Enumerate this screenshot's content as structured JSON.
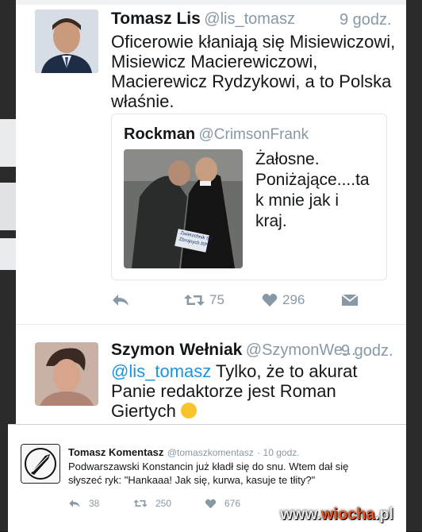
{
  "tweet1": {
    "name": "Tomasz Lis",
    "handle": "@lis_tomasz",
    "time": "9 godz.",
    "lines": [
      "Oficerowie kłaniają się Misiewiczowi,",
      "Misiewicz Macierewiczowi,",
      "Macierewicz Rydzykowi, a to Polska",
      "właśnie."
    ],
    "quote": {
      "name": "Rockman",
      "handle": "@CrimsonFrank",
      "lines": [
        "Żałosne.",
        "Poniżające....ta",
        "k mnie jak i",
        "kraj."
      ],
      "photo_sign": [
        "Zwierzchnik SZ",
        "Zbrojnych RP"
      ]
    },
    "actions": {
      "retweets": "75",
      "likes": "296"
    }
  },
  "tweet2": {
    "name": "Szymon Wełniak",
    "handle": "@SzymonWe...",
    "time": "9 godz.",
    "mention": "@lis_tomasz",
    "lines": [
      " Tylko, że to akurat",
      "Panie redaktorze jest Roman",
      "Giertych"
    ]
  },
  "overlay": {
    "name": "Tomasz Komentasz",
    "handle": "@tomaszkomentasz",
    "time": "· 10 godz.",
    "lines": [
      "Podwarszawski Konstancin już kładł się do snu. Wtem dał się",
      "słyszeć ryk: \"Hankaaa! Jak się, kurwa, kasuje te tłity?\""
    ],
    "actions": {
      "replies": "38",
      "retweets": "250",
      "likes": "676"
    }
  },
  "watermark": {
    "prefix": "www.",
    "brand": "wiocha",
    "suffix": ".pl"
  },
  "colors": {
    "link": "#1b95e0",
    "muted": "#8899a6",
    "divider": "#e6ecf0",
    "watermark_accent": "#e8551f"
  },
  "icons": [
    "reply-icon",
    "retweet-icon",
    "heart-icon",
    "direct-message-icon",
    "quill-pen-icon",
    "grinning-emoji-icon"
  ]
}
